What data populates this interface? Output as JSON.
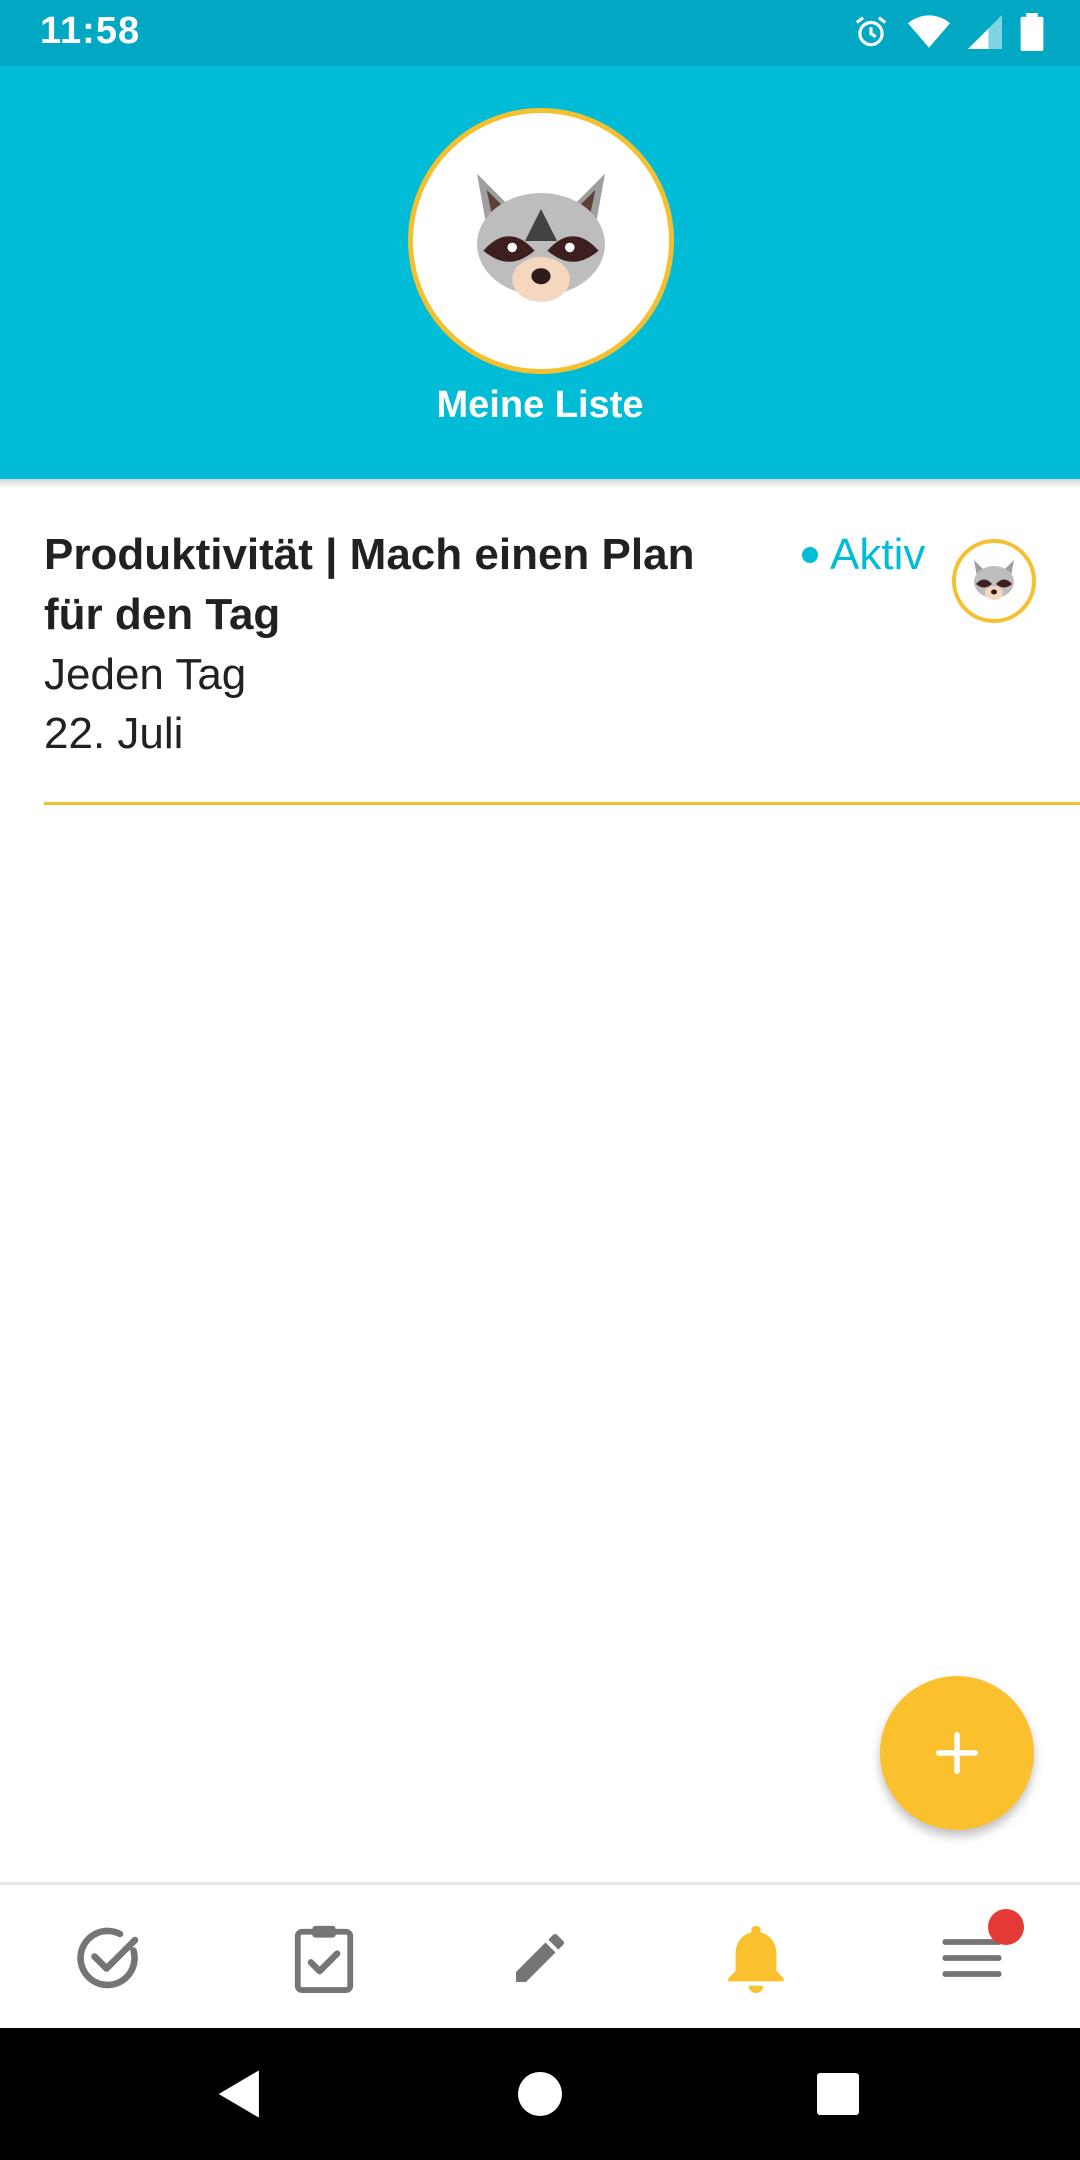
{
  "status_bar": {
    "time": "11:58",
    "icons": [
      "alarm-icon",
      "wifi-icon",
      "cell-signal-icon",
      "battery-icon"
    ]
  },
  "header": {
    "title": "Meine Liste",
    "avatar": "raccoon-avatar"
  },
  "list": {
    "items": [
      {
        "title": "Produktivität | Mach einen Plan für den Tag",
        "frequency": "Jeden Tag",
        "date": "22. Juli",
        "status": "Aktiv",
        "avatar": "raccoon-avatar"
      }
    ]
  },
  "fab": {
    "icon": "plus-icon"
  },
  "bottom_nav": {
    "items": [
      {
        "icon": "check-circle-icon",
        "active": false
      },
      {
        "icon": "clipboard-check-icon",
        "active": false
      },
      {
        "icon": "pencil-icon",
        "active": false
      },
      {
        "icon": "bell-icon",
        "active": true
      },
      {
        "icon": "menu-icon",
        "active": false,
        "badge": true
      }
    ]
  },
  "system_nav": {
    "icons": [
      "back-icon",
      "home-icon",
      "recents-icon"
    ]
  },
  "colors": {
    "header_bg": "#00BCD6",
    "status_bar_bg": "#00A8C4",
    "accent_yellow": "#FBC02D",
    "badge_red": "#E53935",
    "inactive_icon": "#757575"
  }
}
